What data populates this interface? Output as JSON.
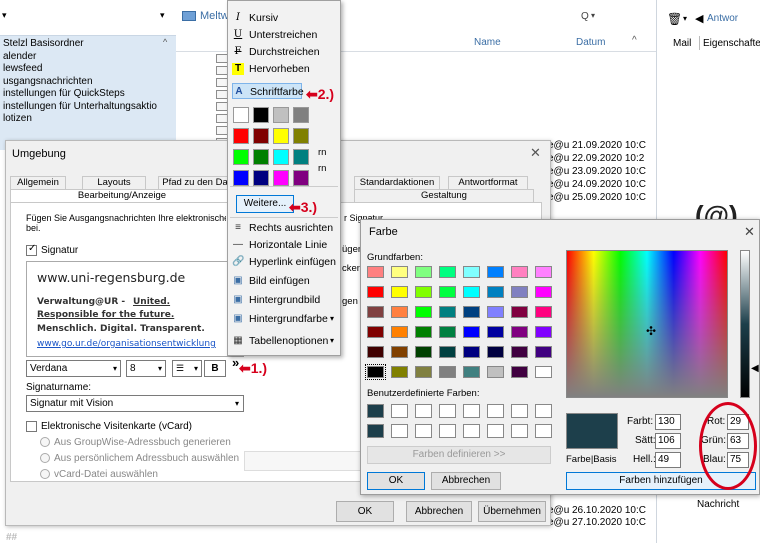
{
  "outlook": {
    "folder_header_label": "",
    "folders": [
      "Stelzl Basisordner",
      "alender",
      "lewsfeed",
      "usgangsnachrichten",
      "instellungen für QuickSteps",
      "instellungen für Unterhaltungsaktio",
      "lotizen"
    ],
    "mail_header": "Meltw",
    "search_label": "Q",
    "columns": {
      "name": "Name",
      "date": "Datum"
    },
    "reading_pane": {
      "reply": "Antwor",
      "tab_mail": "Mail",
      "tab_props": "Eigenschafte",
      "footer": "Nachricht"
    },
    "rows": [
      {
        "from": "e@u",
        "date": "21.09.2020 10:C"
      },
      {
        "from": "e@u",
        "date": "22.09.2020 10:2"
      },
      {
        "from": "e@u",
        "date": "23.09.2020 10:C"
      },
      {
        "from": "e@u",
        "date": "24.09.2020 10:C"
      },
      {
        "from": "e@u",
        "date": "25.09.2020 10:C"
      }
    ],
    "bottom_rows": [
      {
        "from": "e@u",
        "date": "26.10.2020 10:C"
      },
      {
        "from": "e@u",
        "date": "27.10.2020 10:C"
      }
    ]
  },
  "menu": {
    "items": [
      {
        "icon": "I",
        "label": "Kursiv"
      },
      {
        "icon": "U",
        "label": "Unterstreichen"
      },
      {
        "icon": "F",
        "label": "Durchstreichen"
      },
      {
        "icon": "T",
        "label": "Hervorheben"
      },
      {
        "icon": "A",
        "label": "Schriftfarbe"
      }
    ],
    "more_button": "Weitere...",
    "lower_items": [
      {
        "label": "Rechts ausrichten"
      },
      {
        "label": "Horizontale Linie"
      },
      {
        "label": "Hyperlink einfügen"
      },
      {
        "label": "Bild einfügen"
      },
      {
        "label": "Hintergrundbild"
      },
      {
        "label": "Hintergrundfarbe"
      },
      {
        "label": "Tabellenoptionen"
      }
    ],
    "swatches": [
      "#ffffff",
      "#000000",
      "#c0c0c0",
      "#808080",
      "#ff0000",
      "#800000",
      "#ffff00",
      "#808000",
      "#00ff00",
      "#008000",
      "#00ffff",
      "#008080",
      "#0000ff",
      "#000080",
      "#ff00ff",
      "#800080"
    ],
    "partial_text": [
      "rn",
      "rn"
    ]
  },
  "umgebung": {
    "title": "Umgebung",
    "tabs_row1": [
      "Allgemein",
      "Layouts",
      "Pfad zu den Da",
      "Standardaktionen",
      "Antwortformat"
    ],
    "tabs_row2": [
      "Bearbeitung/Anzeige",
      "Gestaltung"
    ],
    "description": "Fügen Sie Ausgangsnachrichten Ihre elektronische",
    "description2": "bei.",
    "description_tail": "r Signatur",
    "signatur_label": "Signatur",
    "sig": {
      "domain": "www.uni-regensburg.de",
      "line1a": "Verwaltung@UR - ",
      "line1b": "United.",
      "line2": "Responsible for the future.",
      "line3": "Menschlich. Digital. Transparent.",
      "link": "www.go.ur.de/organisationsentwicklung"
    },
    "side_texts": [
      "ügen",
      "cken",
      "gen"
    ],
    "font": "Verdana",
    "size": "8",
    "bold": "B",
    "more": "»",
    "signame_label": "Signaturname:",
    "signame_value": "Signatur mit Vision",
    "vcard_label": "Elektronische Visitenkarte (vCard)",
    "vcard_options": [
      "Aus GroupWise-Adressbuch generieren",
      "Aus persönlichem Adressbuch auswählen",
      "vCard-Datei auswählen"
    ],
    "ok": "OK",
    "cancel": "Abbrechen",
    "apply": "Übernehmen"
  },
  "farbe": {
    "title": "Farbe",
    "basic_label": "Grundfarben:",
    "custom_label": "Benutzerdefinierte Farben:",
    "define_button": "Farben definieren >>",
    "ok": "OK",
    "cancel": "Abbrechen",
    "add_button": "Farben hinzufügen",
    "preview_label": "Farbe|Basis",
    "hue_label": "Farbt:",
    "hue": "130",
    "sat_label": "Sätt:",
    "sat": "106",
    "lum_label": "Hell.:",
    "lum": "49",
    "red_label": "Rot:",
    "red": "29",
    "green_label": "Grün:",
    "green": "63",
    "blue_label": "Blau:",
    "blue": "75",
    "selected_color": "#1d3f4b",
    "basic_colors": [
      "#ff8080",
      "#ffff80",
      "#80ff80",
      "#00ff80",
      "#80ffff",
      "#0080ff",
      "#ff80c0",
      "#ff80ff",
      "#ff0000",
      "#ffff00",
      "#80ff00",
      "#00ff40",
      "#00ffff",
      "#0080c0",
      "#8080c0",
      "#ff00ff",
      "#804040",
      "#ff8040",
      "#00ff00",
      "#008080",
      "#004080",
      "#8080ff",
      "#800040",
      "#ff0080",
      "#800000",
      "#ff8000",
      "#008000",
      "#008040",
      "#0000ff",
      "#0000a0",
      "#800080",
      "#8000ff",
      "#400000",
      "#804000",
      "#004000",
      "#004040",
      "#000080",
      "#000040",
      "#400040",
      "#400080",
      "#000000",
      "#808000",
      "#808040",
      "#808080",
      "#408080",
      "#c0c0c0",
      "#400040",
      "#ffffff"
    ],
    "custom_colors": [
      "#1d3f4b",
      "#ffffff",
      "#ffffff",
      "#ffffff",
      "#ffffff",
      "#ffffff",
      "#ffffff",
      "#ffffff",
      "#1d3f4b",
      "#ffffff",
      "#ffffff",
      "#ffffff",
      "#ffffff",
      "#ffffff",
      "#ffffff",
      "#ffffff"
    ]
  },
  "annotations": {
    "a1": "1.)",
    "a2": "2.)",
    "a3": "3.)",
    "accent": "#d6001c"
  },
  "bottom_logo": "##"
}
